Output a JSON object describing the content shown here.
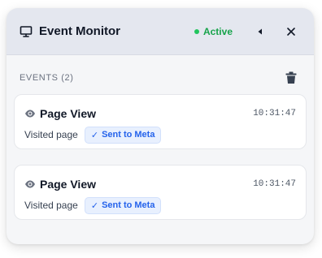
{
  "header": {
    "title": "Event Monitor",
    "status_label": "Active",
    "status_color": "#16a34a",
    "icons": {
      "window": "monitor-icon",
      "collapse": "caret-left-icon",
      "close": "close-icon"
    }
  },
  "toolbar": {
    "events_label": "EVENTS (2)",
    "clear_icon": "trash-icon"
  },
  "events": [
    {
      "name": "Page View",
      "time": "10:31:47",
      "description": "Visited page",
      "badge": "Sent to Meta",
      "badge_icon": "check-icon",
      "icon": "eye-icon"
    },
    {
      "name": "Page View",
      "time": "10:31:47",
      "description": "Visited page",
      "badge": "Sent to Meta",
      "badge_icon": "check-icon",
      "icon": "eye-icon"
    }
  ],
  "colors": {
    "header_bg": "#e4e7ef",
    "badge_bg": "#e8f0fe",
    "badge_text": "#2563eb",
    "active_green": "#16a34a"
  }
}
